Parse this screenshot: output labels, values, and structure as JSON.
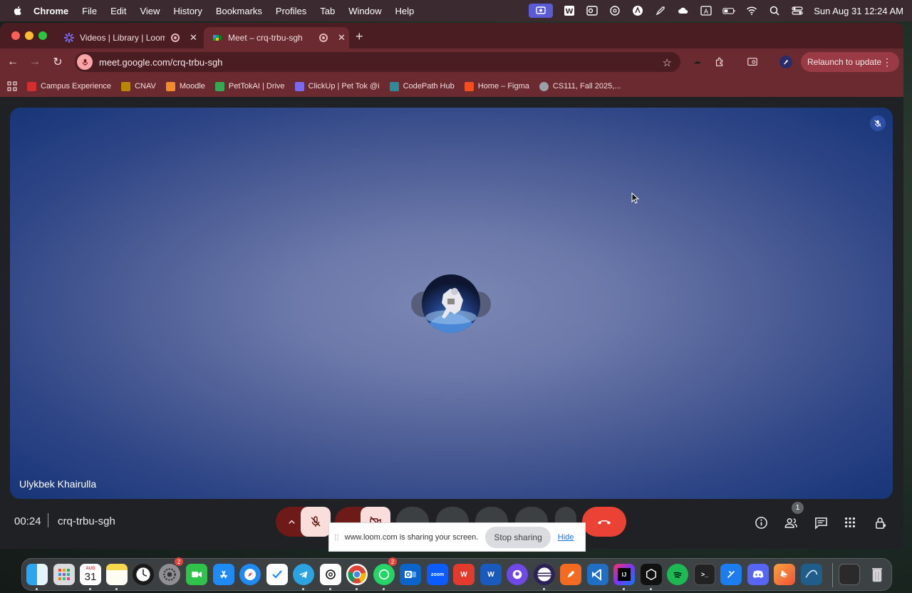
{
  "menubar": {
    "app_name": "Chrome",
    "items": [
      "File",
      "Edit",
      "View",
      "History",
      "Bookmarks",
      "Profiles",
      "Tab",
      "Window",
      "Help"
    ],
    "clock": "Sun Aug 31  12:24 AM",
    "status_icons": [
      "loom-recording-icon",
      "word-icon",
      "outlook-icon",
      "chatgpt-icon",
      "notion-icon",
      "rocket-icon",
      "cloud-icon",
      "keyboard-a-icon",
      "battery-icon",
      "wifi-icon",
      "search-icon",
      "control-center-icon"
    ]
  },
  "browser": {
    "tabs": [
      {
        "title": "Videos | Library | Loom",
        "icon": "loom-icon",
        "active": false
      },
      {
        "title": "Meet – crq-trbu-sgh",
        "icon": "google-meet-icon",
        "active": true
      }
    ],
    "new_tab": "+",
    "url": "meet.google.com/crq-trbu-sgh",
    "relaunch_label": "Relaunch to update",
    "bookmarks": [
      {
        "label": "Campus Experience",
        "color": "#d32f2f"
      },
      {
        "label": "CNAV",
        "color": "#b8860b"
      },
      {
        "label": "Moodle",
        "color": "#f28c28"
      },
      {
        "label": "PetTokAI | Drive",
        "color": "#34a853"
      },
      {
        "label": "ClickUp | Pet Tok @i",
        "color": "#7b68ee"
      },
      {
        "label": "CodePath Hub",
        "color": "#2c8c99"
      },
      {
        "label": "Home – Figma",
        "color": "#f24e1e"
      },
      {
        "label": "CS111, Fall 2025,...",
        "color": "#9aa0a6"
      }
    ]
  },
  "meet": {
    "participant_name": "Ulykbek Khairulla",
    "meeting_time": "00:24",
    "meeting_code": "crq-trbu-sgh",
    "people_count": "1",
    "share_notice": "www.loom.com is sharing your screen.",
    "stop_sharing": "Stop sharing",
    "hide": "Hide"
  },
  "dock": {
    "calendar_month": "AUG",
    "calendar_day": "31",
    "badges": {
      "settings": "2",
      "whatsapp": "2"
    },
    "apps": [
      "Finder",
      "Launchpad",
      "Calendar",
      "Notes",
      "Clock",
      "System Settings",
      "FaceTime",
      "App Store",
      "Safari",
      "Reminders",
      "Telegram",
      "ChatGPT",
      "Chrome",
      "WhatsApp",
      "Outlook",
      "Zoom",
      "WPS Office",
      "Word",
      "GitHub Desktop",
      "Eclipse",
      "Pen",
      "VS Code",
      "IntelliJ IDEA",
      "Unity",
      "Spotify",
      "Terminal",
      "Xcode",
      "Discord",
      "Swift",
      "MySQL Workbench",
      "Screen",
      "Trash"
    ]
  },
  "colors": {
    "tab_strip": "#4a1d22",
    "toolbar": "#6a2a30",
    "hangup": "#ea4335",
    "mic_off_active": "#f9dedc"
  }
}
